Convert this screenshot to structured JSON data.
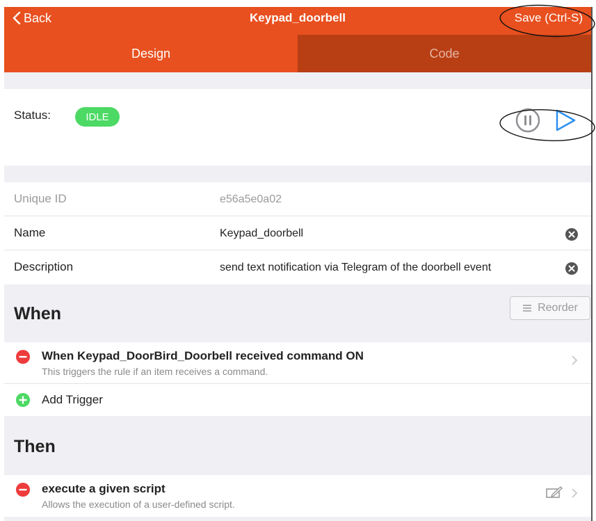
{
  "header": {
    "back_label": "Back",
    "title": "Keypad_doorbell",
    "save_label": "Save (Ctrl-S)"
  },
  "tabs": [
    {
      "label": "Design",
      "active": true
    },
    {
      "label": "Code",
      "active": false
    }
  ],
  "status": {
    "label": "Status:",
    "value": "IDLE",
    "badge_color": "#4cd964"
  },
  "properties": [
    {
      "label": "Unique ID",
      "value": "e56a5e0a02",
      "readonly": true
    },
    {
      "label": "Name",
      "value": "Keypad_doorbell",
      "readonly": false
    },
    {
      "label": "Description",
      "value": "send text notification via Telegram of the doorbell event",
      "readonly": false
    }
  ],
  "when": {
    "title": "When",
    "reorder_label": "Reorder",
    "triggers": [
      {
        "title": "When Keypad_DoorBird_Doorbell received command ON",
        "description": "This triggers the rule if an item receives a command."
      }
    ],
    "add_label": "Add Trigger"
  },
  "then": {
    "title": "Then",
    "actions": [
      {
        "title": "execute a given script",
        "description": "Allows the execution of a user-defined script."
      }
    ]
  },
  "colors": {
    "brand": "#e8501f",
    "brand_dark": "#b83e14",
    "remove": "#ee3b3b",
    "add": "#4cd964",
    "play": "#2f8ff0"
  }
}
